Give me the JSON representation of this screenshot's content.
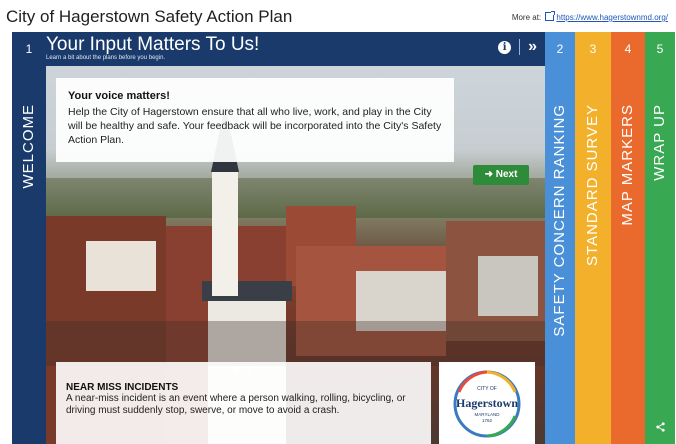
{
  "app_title": "City of Hagerstown Safety Action Plan",
  "more_at": {
    "label": "More at:",
    "url": "https://www.hagerstownmd.org/"
  },
  "tabs": [
    {
      "number": "1",
      "label": "WELCOME",
      "color": "#193a6a",
      "active": true
    },
    {
      "number": "2",
      "label": "SAFETY CONCERN RANKING",
      "color": "#4a90d9"
    },
    {
      "number": "3",
      "label": "STANDARD SURVEY",
      "color": "#f3b12b"
    },
    {
      "number": "4",
      "label": "MAP MARKERS",
      "color": "#ea6a2e"
    },
    {
      "number": "5",
      "label": "WRAP UP",
      "color": "#38a852"
    }
  ],
  "panel": {
    "title": "Your Input Matters To Us!",
    "subtitle": "Learn a bit about the plans before you begin.",
    "icons": [
      "info-icon",
      "skip-forward-icon"
    ]
  },
  "voice_card": {
    "title": "Your voice matters!",
    "text": "Help the City of Hagerstown ensure that all who live, work, and play in the City will be healthy and safe. Your feedback will be incorporated into the City's Safety Action Plan."
  },
  "next_button": "➜ Next",
  "carousel": {
    "slides": 2,
    "active_index": 0
  },
  "near_miss": {
    "title": "NEAR MISS INCIDENTS",
    "text": "A near-miss incident is an event where a person walking, rolling, bicycling, or driving must suddenly stop, swerve, or move to avoid a crash."
  },
  "logo": {
    "top": "CITY OF",
    "name": "Hagerstown",
    "state": "MARYLAND",
    "year": "1762"
  }
}
